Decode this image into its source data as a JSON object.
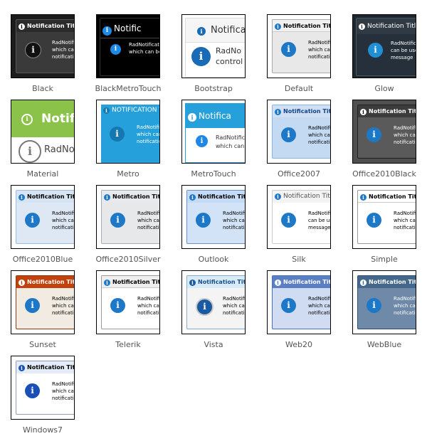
{
  "notification": {
    "title": "Notification Title",
    "title_upper": "NOTIFICATION TITLE",
    "title_short": "Notific",
    "title_short_bootstrap": "Notifica",
    "title_xl": "Notifi",
    "text_lines": [
      "RadNotification",
      "which can be used",
      "notification"
    ],
    "text_lines_alt": [
      "RadNotification",
      "can be used to",
      "message"
    ],
    "text_lines_bootstrap": [
      "RadNo",
      "control"
    ],
    "text_lines_material": [
      "RadNo"
    ],
    "text_lines_metrotouch": [
      "RadNotifica",
      "which can"
    ],
    "info_glyph": "i"
  },
  "skins": [
    {
      "name": "Black",
      "title_bg": "#2b2b2b",
      "title_color": "#ffffff",
      "body_bg": "#3a3a3a",
      "body_color": "#ffffff",
      "icon_color": "#111111"
    },
    {
      "name": "BlackMetroTouch",
      "title_bg": "#000000",
      "title_color": "#ffffff",
      "body_bg": "#000000",
      "body_color": "#ffffff",
      "icon_color": "#1e88e5"
    },
    {
      "name": "Bootstrap",
      "title_bg": "#f5f5f5",
      "title_color": "#333333",
      "body_bg": "#ffffff",
      "body_color": "#333333",
      "icon_color": "#1a6bb5"
    },
    {
      "name": "Default",
      "title_bg": "#f0f0f0",
      "title_color": "#000000",
      "body_bg": "#e8e8e8",
      "body_color": "#000000",
      "icon_color": "#1d78c7"
    },
    {
      "name": "Glow",
      "title_bg": "#2f3a45",
      "title_color": "#ffffff",
      "body_bg": "#25303a",
      "body_color": "#ffffff",
      "icon_color": "#1f8fd6"
    },
    {
      "name": "Material",
      "title_bg": "#8bc34a",
      "title_color": "#ffffff",
      "body_bg": "#ffffff",
      "body_color": "#333333",
      "icon_color": "#8bc34a"
    },
    {
      "name": "Metro",
      "title_bg": "#25a0da",
      "title_color": "#ffffff",
      "body_bg": "#25a0da",
      "body_color": "#ffffff",
      "icon_color": "#1578b0"
    },
    {
      "name": "MetroTouch",
      "title_bg": "#25a0da",
      "title_color": "#ffffff",
      "body_bg": "#ffffff",
      "body_color": "#333333",
      "icon_color": "#1e88e5"
    },
    {
      "name": "Office2007",
      "title_bg": "#cfe0f4",
      "title_color": "#15428b",
      "body_bg": "#c4d9f2",
      "body_color": "#000000",
      "icon_color": "#1d78c7"
    },
    {
      "name": "Office2010Black",
      "title_bg": "#3c3c3c",
      "title_color": "#ffffff",
      "body_bg": "#5a5a5a",
      "body_color": "#ffffff",
      "icon_color": "#1d78c7"
    },
    {
      "name": "Office2010Blue",
      "title_bg": "#d5e3f2",
      "title_color": "#000000",
      "body_bg": "#dde8f4",
      "body_color": "#000000",
      "icon_color": "#1d78c7"
    },
    {
      "name": "Office2010Silver",
      "title_bg": "#e6e9ed",
      "title_color": "#000000",
      "body_bg": "#e6e8ea",
      "body_color": "#000000",
      "icon_color": "#1d78c7"
    },
    {
      "name": "Outlook",
      "title_bg": "#c5daf5",
      "title_color": "#000000",
      "body_bg": "#d3e3f7",
      "body_color": "#000000",
      "icon_color": "#1d78c7"
    },
    {
      "name": "Silk",
      "title_bg": "#f3f3f3",
      "title_color": "#555555",
      "body_bg": "#ffffff",
      "body_color": "#000000",
      "icon_color": "#1d78c7"
    },
    {
      "name": "Simple",
      "title_bg": "#ffffff",
      "title_color": "#000000",
      "body_bg": "#ffffff",
      "body_color": "#000000",
      "icon_color": "#1d78c7"
    },
    {
      "name": "Sunset",
      "title_bg": "#c2410c",
      "title_color": "#ffffff",
      "body_bg": "#f2ebe2",
      "body_color": "#000000",
      "icon_color": "#1d78c7"
    },
    {
      "name": "Telerik",
      "title_bg": "#eeeeee",
      "title_color": "#000000",
      "body_bg": "#ffffff",
      "body_color": "#000000",
      "icon_color": "#1d78c7"
    },
    {
      "name": "Vista",
      "title_bg": "#d8ecf8",
      "title_color": "#1b4f8c",
      "body_bg": "#f4f4f4",
      "body_color": "#000000",
      "icon_color": "#1a5aa0"
    },
    {
      "name": "Web20",
      "title_bg": "#5b7fc4",
      "title_color": "#ffffff",
      "body_bg": "#cfdcf2",
      "body_color": "#000000",
      "icon_color": "#1d78c7"
    },
    {
      "name": "WebBlue",
      "title_bg": "#44688c",
      "title_color": "#ffffff",
      "body_bg": "#6f8aa8",
      "body_color": "#ffffff",
      "icon_color": "#1d78c7"
    },
    {
      "name": "Windows7",
      "title_bg": "#e3ecf7",
      "title_color": "#000000",
      "body_bg": "#ffffff",
      "body_color": "#000000",
      "icon_color": "#1a4fb8"
    }
  ]
}
